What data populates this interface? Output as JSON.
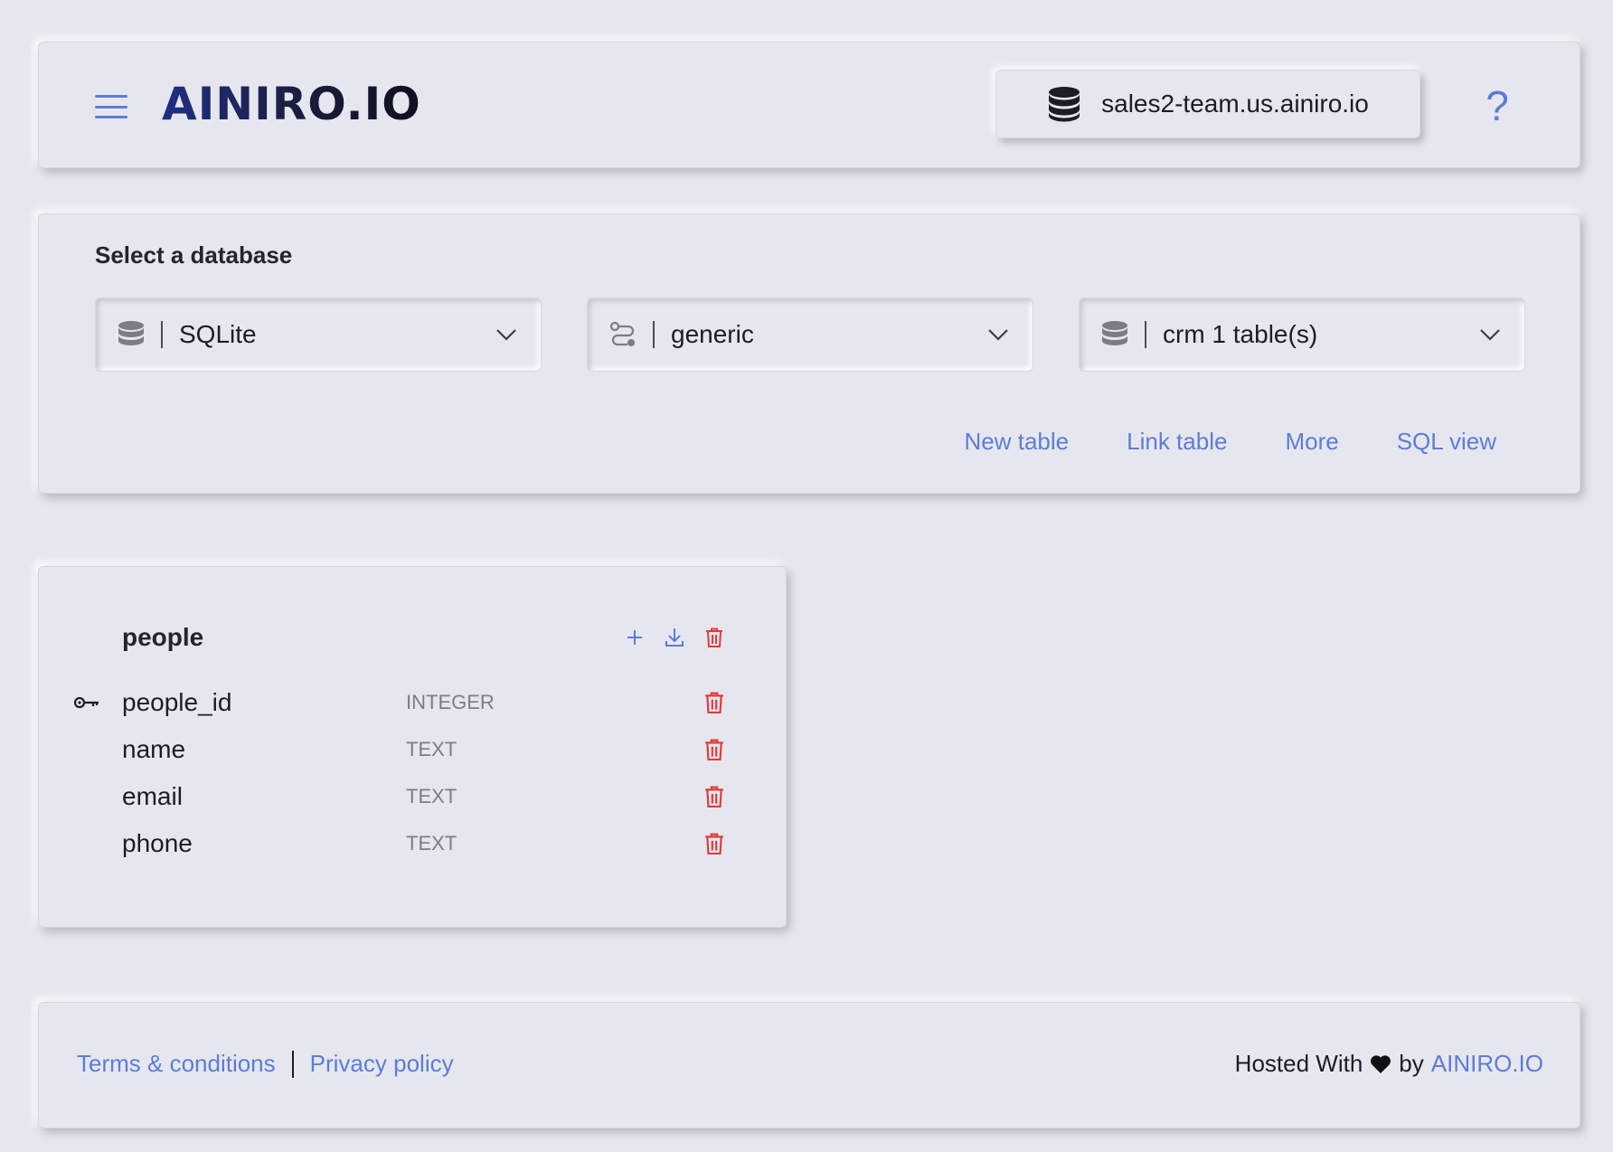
{
  "header": {
    "logo_text": "AINIRO.IO",
    "server_label": "sales2-team.us.ainiro.io",
    "help_label": "?"
  },
  "db_selector": {
    "title": "Select a database",
    "selects": [
      {
        "value": "SQLite",
        "icon": "database-icon"
      },
      {
        "value": "generic",
        "icon": "connection-icon"
      },
      {
        "value": "crm 1 table(s)",
        "icon": "database-icon"
      }
    ],
    "actions": [
      "New table",
      "Link table",
      "More",
      "SQL view"
    ]
  },
  "table": {
    "name": "people",
    "columns": [
      {
        "name": "people_id",
        "type": "INTEGER",
        "primary_key": true
      },
      {
        "name": "name",
        "type": "TEXT",
        "primary_key": false
      },
      {
        "name": "email",
        "type": "TEXT",
        "primary_key": false
      },
      {
        "name": "phone",
        "type": "TEXT",
        "primary_key": false
      }
    ]
  },
  "footer": {
    "terms": "Terms & conditions",
    "privacy": "Privacy policy",
    "hosted_prefix": "Hosted With",
    "by": "by",
    "brand_link": "AINIRO.IO"
  },
  "colors": {
    "background": "#e6e7ee",
    "accent": "#5c7cd8",
    "danger": "#e03c3c"
  }
}
